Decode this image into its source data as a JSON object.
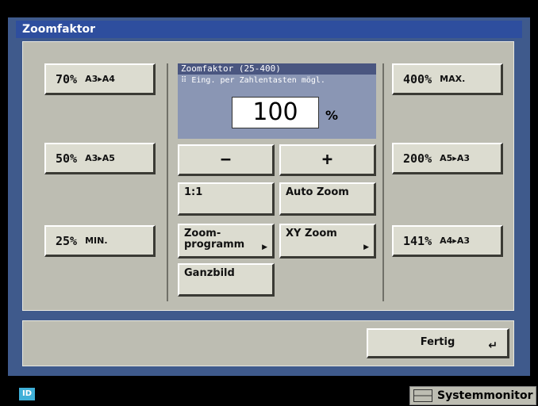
{
  "window": {
    "title": "Zoomfaktor"
  },
  "left_buttons": [
    {
      "pct": "70%",
      "sub": "A3▸A4"
    },
    {
      "pct": "50%",
      "sub": "A3▸A5"
    },
    {
      "pct": "25%",
      "sub": "MIN."
    }
  ],
  "right_buttons": [
    {
      "pct": "400%",
      "sub": "MAX."
    },
    {
      "pct": "200%",
      "sub": "A5▸A3"
    },
    {
      "pct": "141%",
      "sub": "A4▸A3"
    }
  ],
  "display": {
    "header": "Zoomfaktor (25-400)",
    "hint": "Eing. per Zahlentasten mögl.",
    "value": "100",
    "unit": "%"
  },
  "controls": {
    "minus": "−",
    "plus": "+",
    "one_to_one": "1:1",
    "auto_zoom": "Auto Zoom",
    "zoom_program_line1": "Zoom-",
    "zoom_program_line2": "programm",
    "xy_zoom": "XY Zoom",
    "ganzbild": "Ganzbild",
    "submenu_arrow": "▶"
  },
  "footer": {
    "done": "Fertig",
    "done_icon": "return-arrow-icon",
    "done_glyph": "↵"
  },
  "statusbar": {
    "id_label": "ID",
    "system_monitor": "Systemmonitor"
  }
}
